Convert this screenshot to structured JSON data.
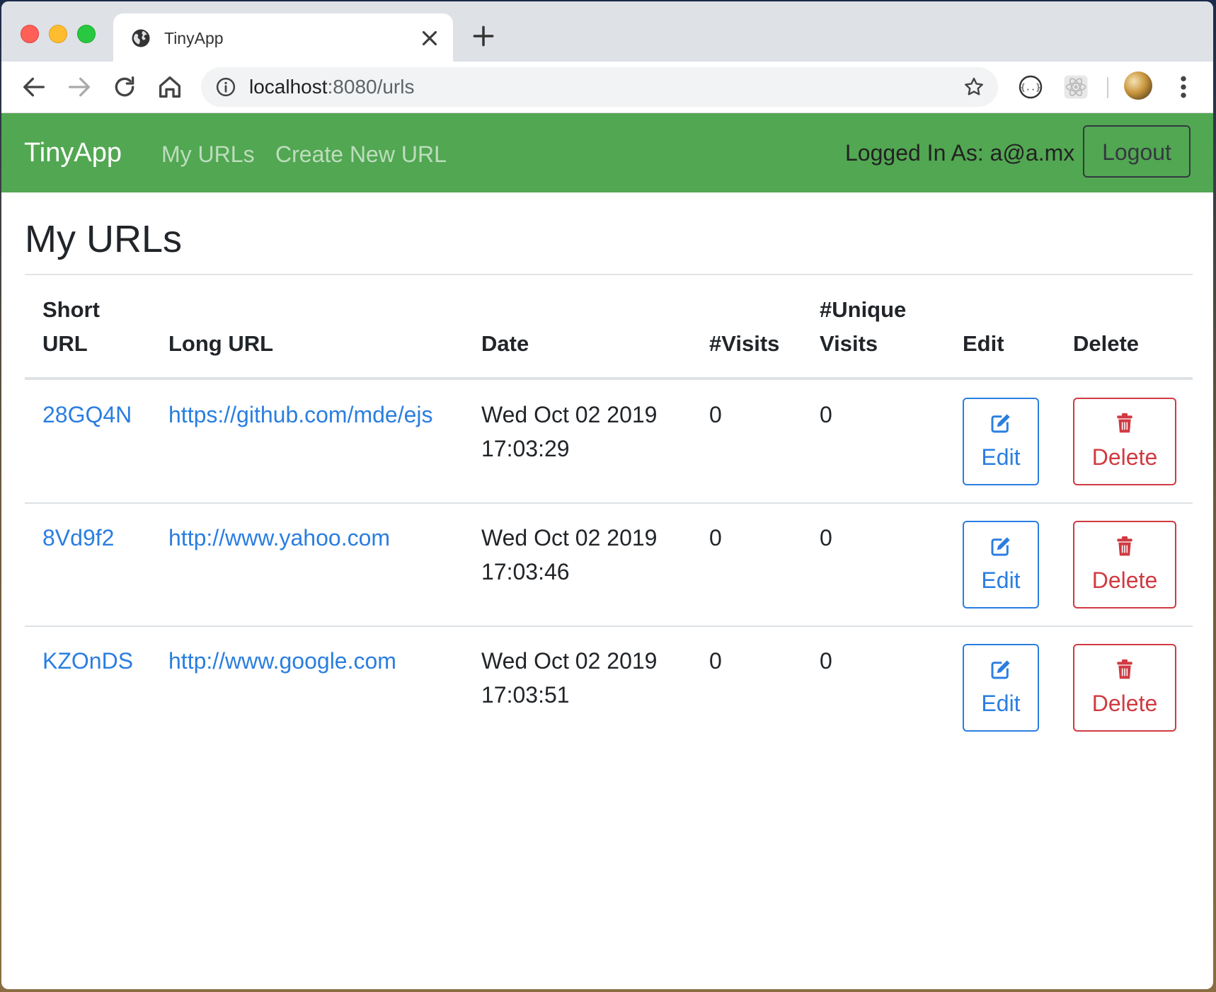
{
  "browser": {
    "tab_title": "TinyApp",
    "url_host": "localhost",
    "url_rest": ":8080/urls"
  },
  "navbar": {
    "brand": "TinyApp",
    "links": [
      "My URLs",
      "Create New URL"
    ],
    "logged_in_text": "Logged In As: a@a.mx",
    "logout_label": "Logout"
  },
  "page": {
    "title": "My URLs"
  },
  "table": {
    "headers": {
      "short_url_1": "Short",
      "short_url_2": "URL",
      "long_url": "Long URL",
      "date": "Date",
      "visits": "#Visits",
      "unique_1": "#Unique",
      "unique_2": "Visits",
      "edit": "Edit",
      "delete": "Delete"
    },
    "rows": [
      {
        "short": "28GQ4N",
        "long": "https://github.com/mde/ejs",
        "date_1": "Wed Oct 02 2019",
        "date_2": "17:03:29",
        "visits": "0",
        "unique": "0",
        "edit_label": "Edit",
        "delete_label": "Delete"
      },
      {
        "short": "8Vd9f2",
        "long": "http://www.yahoo.com",
        "date_1": "Wed Oct 02 2019",
        "date_2": "17:03:46",
        "visits": "0",
        "unique": "0",
        "edit_label": "Edit",
        "delete_label": "Delete"
      },
      {
        "short": "KZOnDS",
        "long": "http://www.google.com",
        "date_1": "Wed Oct 02 2019",
        "date_2": "17:03:51",
        "visits": "0",
        "unique": "0",
        "edit_label": "Edit",
        "delete_label": "Delete"
      }
    ]
  },
  "colors": {
    "navbar_bg": "#52a752",
    "link": "#2a7ee0",
    "danger": "#d03a42"
  },
  "icons": {
    "tab": "globe-icon",
    "edit": "pencil-square-icon",
    "delete": "trash-icon"
  }
}
